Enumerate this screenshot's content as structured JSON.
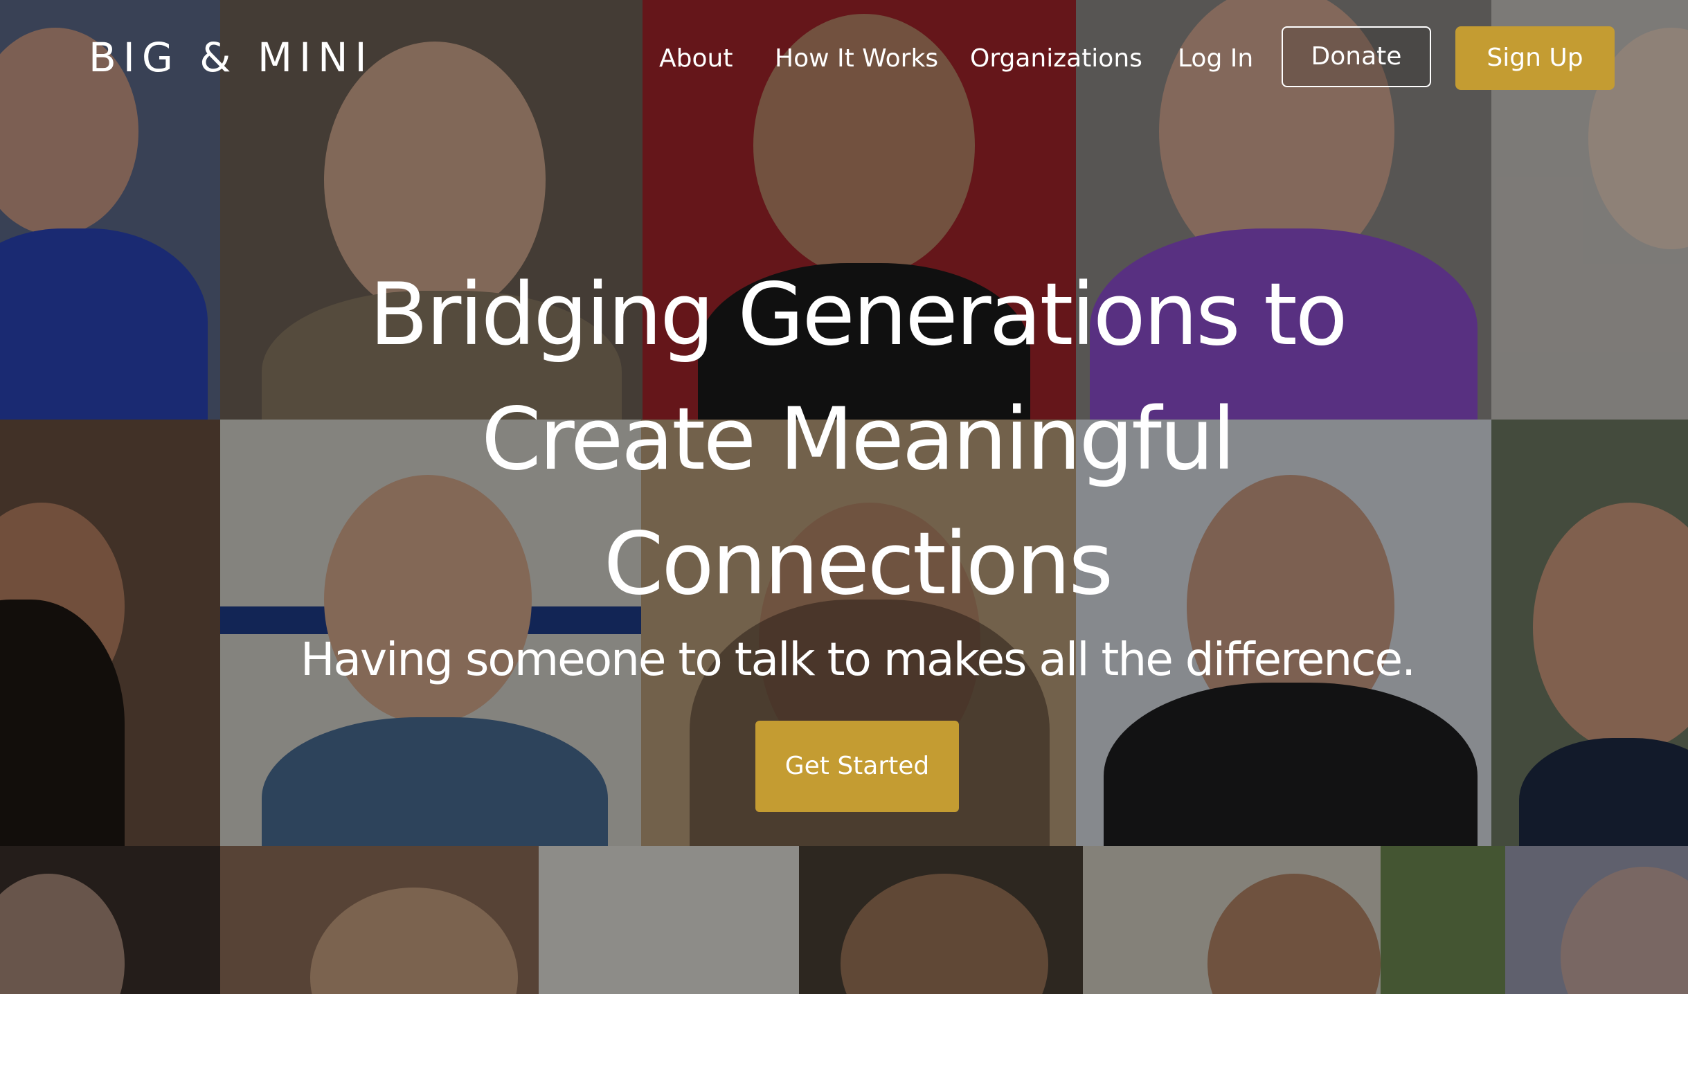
{
  "brand": {
    "logo_text": "BIG & MINI",
    "accent_color": "#c49c32"
  },
  "nav": {
    "links": [
      "About",
      "How It Works",
      "Organizations",
      "Log In"
    ],
    "donate_label": "Donate",
    "signup_label": "Sign Up"
  },
  "hero": {
    "headline_lines": [
      "Bridging Generations to",
      "Create Meaningful",
      "Connections"
    ],
    "subheadline": "Having someone to talk to makes all the difference.",
    "cta_label": "Get Started",
    "background": "video-call-collage-photo"
  }
}
